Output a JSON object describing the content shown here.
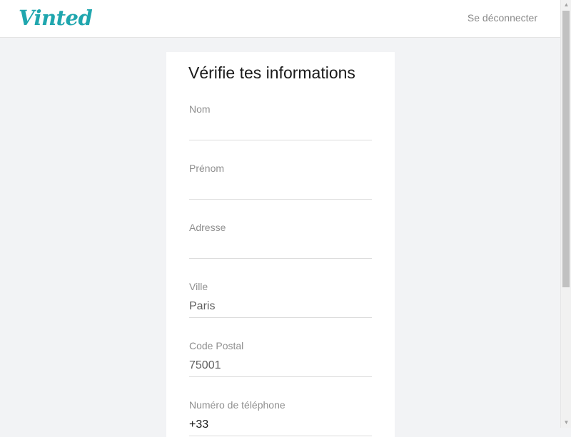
{
  "header": {
    "logo": "Vinted",
    "logout_label": "Se déconnecter"
  },
  "form": {
    "title": "Vérifie tes informations",
    "fields": [
      {
        "label": "Nom",
        "value": ""
      },
      {
        "label": "Prénom",
        "value": ""
      },
      {
        "label": "Adresse",
        "value": ""
      },
      {
        "label": "Ville",
        "value": "Paris"
      },
      {
        "label": "Code Postal",
        "value": "75001"
      },
      {
        "label": "Numéro de téléphone",
        "value": "+33"
      }
    ]
  },
  "colors": {
    "brand": "#1fa6ae",
    "background": "#f2f3f5"
  }
}
